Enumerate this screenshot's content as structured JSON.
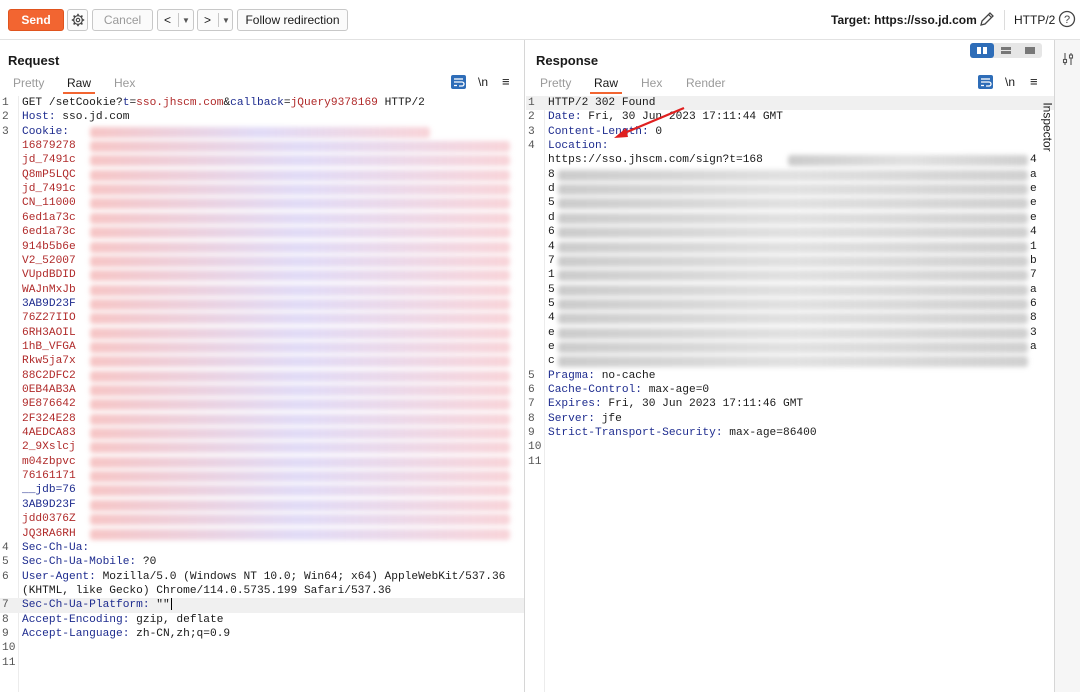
{
  "toolbar": {
    "send_label": "Send",
    "cancel_label": "Cancel",
    "back_label": "<",
    "forward_label": ">",
    "follow_label": "Follow redirection",
    "target_label": "Target: https://sso.jd.com",
    "http_version": "HTTP/2",
    "icons": [
      "gear-icon",
      "pencil-icon",
      "help-icon",
      "dropdown-icon"
    ],
    "accent_color": "#f26531"
  },
  "request": {
    "title": "Request",
    "tabs": [
      "Pretty",
      "Raw",
      "Hex"
    ],
    "active_tab": "Raw",
    "newline_label": "\\n",
    "menu_label": "≡",
    "lines": [
      {
        "n": "1",
        "k": "",
        "v": "GET /setCookie?t=sso.jhscm.com&callback=jQuery9378169 HTTP/2"
      },
      {
        "n": "2",
        "k": "Host:",
        "v": " sso.jd.com"
      },
      {
        "n": "3",
        "k": "Cookie:",
        "v": ""
      },
      {
        "n": "",
        "k": "",
        "v": "16879278"
      },
      {
        "n": "",
        "k": "",
        "v": "jd_7491c"
      },
      {
        "n": "",
        "k": "",
        "v": "Q8mP5LQC"
      },
      {
        "n": "",
        "k": "",
        "v": "jd_7491c"
      },
      {
        "n": "",
        "k": "",
        "v": "CN_11000"
      },
      {
        "n": "",
        "k": "",
        "v": "6ed1a73c"
      },
      {
        "n": "",
        "k": "",
        "v": "6ed1a73c"
      },
      {
        "n": "",
        "k": "",
        "v": "914b5b6e"
      },
      {
        "n": "",
        "k": "",
        "v": "V2_52007"
      },
      {
        "n": "",
        "k": "",
        "v": "VUpdBDID"
      },
      {
        "n": "",
        "k": "",
        "v": "WAJnMxJb"
      },
      {
        "n": "",
        "k": "",
        "v": "3AB9D23F"
      },
      {
        "n": "",
        "k": "",
        "v": "76Z27IIO"
      },
      {
        "n": "",
        "k": "",
        "v": "6RH3AOIL"
      },
      {
        "n": "",
        "k": "",
        "v": "1hB_VFGA"
      },
      {
        "n": "",
        "k": "",
        "v": "Rkw5ja7x"
      },
      {
        "n": "",
        "k": "",
        "v": "88C2DFC2"
      },
      {
        "n": "",
        "k": "",
        "v": "0EB4AB3A"
      },
      {
        "n": "",
        "k": "",
        "v": "9E876642"
      },
      {
        "n": "",
        "k": "",
        "v": "2F324E28"
      },
      {
        "n": "",
        "k": "",
        "v": "4AEDCA83"
      },
      {
        "n": "",
        "k": "",
        "v": "2_9Xslcj"
      },
      {
        "n": "",
        "k": "",
        "v": "m04zbpvc"
      },
      {
        "n": "",
        "k": "",
        "v": "76161171"
      },
      {
        "n": "",
        "k": "",
        "v": "__jdb=76"
      },
      {
        "n": "",
        "k": "",
        "v": "3AB9D23F"
      },
      {
        "n": "",
        "k": "",
        "v": "jdd0376Z"
      },
      {
        "n": "",
        "k": "",
        "v": "JQ3RA6RH"
      },
      {
        "n": "4",
        "k": "Sec-Ch-Ua:",
        "v": ""
      },
      {
        "n": "5",
        "k": "Sec-Ch-Ua-Mobile:",
        "v": " ?0"
      },
      {
        "n": "6",
        "k": "User-Agent:",
        "v": " Mozilla/5.0 (Windows NT 10.0; Win64; x64) AppleWebKit/537.36"
      },
      {
        "n": "",
        "k": "",
        "v": " (KHTML, like Gecko) Chrome/114.0.5735.199 Safari/537.36"
      },
      {
        "n": "7",
        "k": "Sec-Ch-Ua-Platform:",
        "v": " \"\""
      },
      {
        "n": "8",
        "k": "Accept-Encoding:",
        "v": " gzip, deflate"
      },
      {
        "n": "9",
        "k": "Accept-Language:",
        "v": " zh-CN,zh;q=0.9"
      },
      {
        "n": "10",
        "k": "",
        "v": ""
      },
      {
        "n": "11",
        "k": "",
        "v": ""
      }
    ]
  },
  "response": {
    "title": "Response",
    "tabs": [
      "Pretty",
      "Raw",
      "Hex",
      "Render"
    ],
    "active_tab": "Raw",
    "newline_label": "\\n",
    "menu_label": "≡",
    "lines": [
      {
        "n": "1",
        "k": "",
        "v": "HTTP/2 302 Found"
      },
      {
        "n": "2",
        "k": "Date:",
        "v": " Fri, 30 Jun 2023 17:11:44 GMT"
      },
      {
        "n": "3",
        "k": "Content-Length:",
        "v": " 0"
      },
      {
        "n": "4",
        "k": "Location:",
        "v": ""
      },
      {
        "n": "",
        "k": "",
        "v": "https://sso.jhscm.com/sign?t=168"
      },
      {
        "n": "",
        "k": "",
        "v": "8"
      },
      {
        "n": "",
        "k": "",
        "v": "d"
      },
      {
        "n": "",
        "k": "",
        "v": "5"
      },
      {
        "n": "",
        "k": "",
        "v": "d"
      },
      {
        "n": "",
        "k": "",
        "v": "6"
      },
      {
        "n": "",
        "k": "",
        "v": "4"
      },
      {
        "n": "",
        "k": "",
        "v": "7"
      },
      {
        "n": "",
        "k": "",
        "v": "1"
      },
      {
        "n": "",
        "k": "",
        "v": "5"
      },
      {
        "n": "",
        "k": "",
        "v": "5"
      },
      {
        "n": "",
        "k": "",
        "v": "4"
      },
      {
        "n": "",
        "k": "",
        "v": "e"
      },
      {
        "n": "",
        "k": "",
        "v": "e"
      },
      {
        "n": "",
        "k": "",
        "v": "c"
      },
      {
        "n": "5",
        "k": "Pragma:",
        "v": " no-cache"
      },
      {
        "n": "6",
        "k": "Cache-Control:",
        "v": " max-age=0"
      },
      {
        "n": "7",
        "k": "Expires:",
        "v": " Fri, 30 Jun 2023 17:11:46 GMT"
      },
      {
        "n": "8",
        "k": "Server:",
        "v": " jfe"
      },
      {
        "n": "9",
        "k": "Strict-Transport-Security:",
        "v": " max-age=86400"
      },
      {
        "n": "10",
        "k": "",
        "v": ""
      },
      {
        "n": "11",
        "k": "",
        "v": ""
      }
    ],
    "location_right_chars": [
      "4",
      "a",
      "e",
      "e",
      "e",
      "4",
      "1",
      "b",
      "7",
      "a",
      "6",
      "8",
      "3",
      "a"
    ]
  },
  "inspector": {
    "label": "Inspector"
  }
}
